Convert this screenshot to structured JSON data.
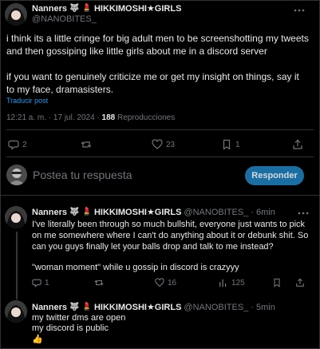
{
  "main_post": {
    "author_name": "Nanners",
    "author_title": "HIKKIMOSHI★GIRLS",
    "handle": "@NANOBITES_",
    "text_p1": "i think its a little cringe for big adult men to be screenshotting my tweets and then gossiping like little girls about me in a discord server",
    "text_p2": "if you want to genuinely criticize me or get my insight on things, say it to my face, dramasisters.",
    "translate": "Traducir post",
    "timestamp": "12:21 a. m. · 17 jul. 2024 · ",
    "views_count": "188",
    "views_label": " Reproducciones",
    "replies": "2",
    "reposts": "",
    "likes": "23",
    "bookmarks": "1"
  },
  "reply_composer": {
    "placeholder": "Postea tu respuesta",
    "button": "Responder"
  },
  "replies": [
    {
      "author_name": "Nanners",
      "author_title": "HIKKIMOSHI★GIRLS",
      "handle": "@NANOBITES_",
      "time": "· 6min",
      "text_p1": "I've literally been through so much bullshit, everyone just wants to pick on me somewhere where I can't do anything about it or debunk shit. So can you guys finally let your balls drop and talk to me instead?",
      "text_p2": "\"woman moment\" while u gossip in discord is crazyyy",
      "replies": "1",
      "likes": "16",
      "views": "125"
    },
    {
      "author_name": "Nanners",
      "author_title": "HIKKIMOSHI★GIRLS",
      "handle": "@NANOBITES_",
      "time": "· 5min",
      "line1": "my twitter dms are open",
      "line2": "my discord is public",
      "emoji": "👍"
    }
  ],
  "colors": {
    "accent": "#1d9bf0",
    "button_bg": "#1a6ea3",
    "muted": "#71767b",
    "border": "#2f3336"
  }
}
